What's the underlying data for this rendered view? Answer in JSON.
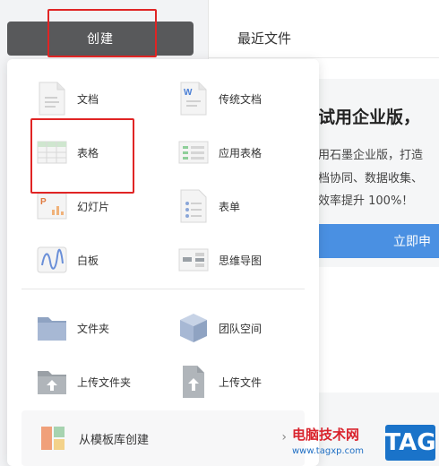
{
  "sidebar": {
    "create_label": "创建"
  },
  "main": {
    "recent_title": "最近文件",
    "promo": {
      "title": "试用企业版，",
      "lines": [
        "用石墨企业版，打造",
        "档协同、数据收集、",
        "效率提升 100%！"
      ],
      "cta": "立即申"
    }
  },
  "menu": {
    "items": [
      {
        "label": "文档",
        "icon": "doc-icon"
      },
      {
        "label": "传统文档",
        "icon": "word-doc-icon"
      },
      {
        "label": "表格",
        "icon": "sheet-icon"
      },
      {
        "label": "应用表格",
        "icon": "app-sheet-icon"
      },
      {
        "label": "幻灯片",
        "icon": "slides-icon"
      },
      {
        "label": "表单",
        "icon": "form-icon"
      },
      {
        "label": "白板",
        "icon": "whiteboard-icon"
      },
      {
        "label": "思维导图",
        "icon": "mindmap-icon"
      },
      {
        "label": "文件夹",
        "icon": "folder-icon"
      },
      {
        "label": "团队空间",
        "icon": "team-space-icon"
      },
      {
        "label": "上传文件夹",
        "icon": "upload-folder-icon"
      },
      {
        "label": "上传文件",
        "icon": "upload-file-icon"
      }
    ],
    "template_label": "从模板库创建"
  },
  "watermark": {
    "title": "电脑技术网",
    "url": "www.tagxp.com",
    "tag": "TAG"
  },
  "colors": {
    "highlight": "#e02424",
    "create_button": "#58595b",
    "cta": "#4a90e2"
  }
}
